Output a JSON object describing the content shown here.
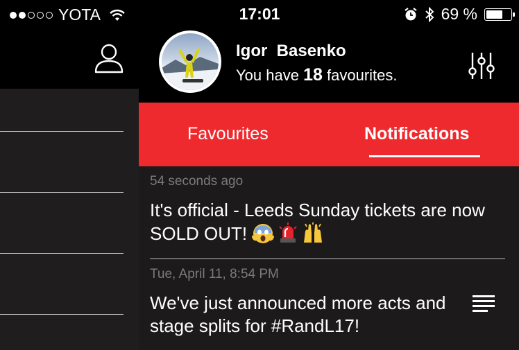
{
  "status_bar": {
    "carrier": "YOTA",
    "time": "17:01",
    "battery_percent": "69 %",
    "battery_level": 0.69,
    "signal_bars_filled": 2,
    "signal_bars_total": 5
  },
  "sidebar": {
    "header_icon": "user-icon",
    "items": [
      "",
      "",
      "",
      ""
    ]
  },
  "profile": {
    "first_name": "Igor",
    "last_name": "Basenko",
    "sub_prefix": "You have",
    "favourites_count": "18",
    "sub_suffix": "favourites.",
    "settings_icon": "sliders-icon"
  },
  "tabs": [
    {
      "label": "Favourites",
      "active": false
    },
    {
      "label": "Notifications",
      "active": true
    }
  ],
  "notifications": [
    {
      "time": "54 seconds ago",
      "text": "It's official - Leeds Sunday tickets are now SOLD OUT!",
      "emojis": [
        "screaming-face-emoji",
        "police-light-emoji",
        "raised-hands-emoji"
      ]
    },
    {
      "time": "Tue, April 11, 8:54 PM",
      "text": "We've just announced more acts and stage splits for #RandL17!",
      "icon": "list-icon"
    }
  ],
  "colors": {
    "accent_red": "#ee2a2e",
    "panel_dark": "#1d1a1b",
    "timestamp_gray": "#7d7a7b"
  }
}
